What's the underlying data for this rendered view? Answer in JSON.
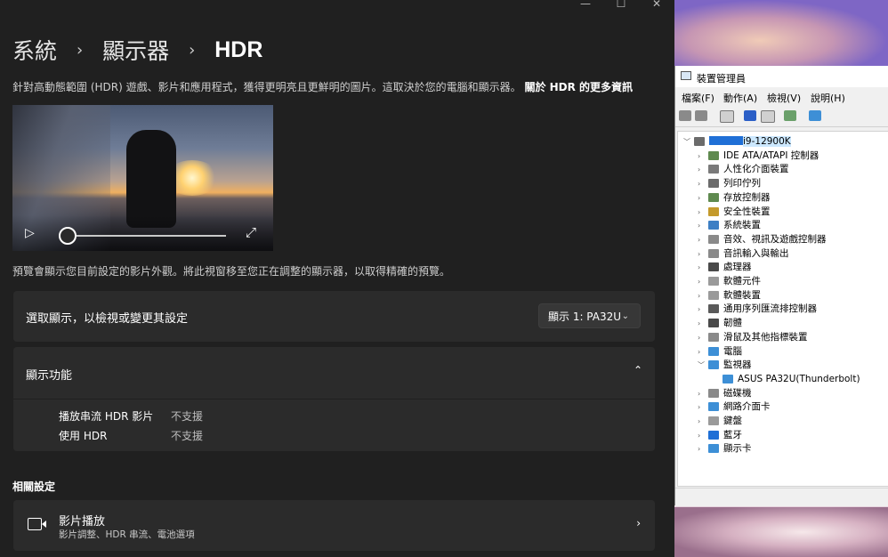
{
  "window": {
    "minimize_icon": "minimize-icon",
    "maximize_icon": "maximize-icon",
    "close_icon": "close-icon",
    "min_glyph": "—",
    "max_glyph": "☐",
    "close_glyph": "✕"
  },
  "breadcrumb": {
    "items": [
      "系統",
      "顯示器",
      "HDR"
    ],
    "separator": "›"
  },
  "description": {
    "text": "針對高動態範圍 (HDR) 遊戲、影片和應用程式，獲得更明亮且更鮮明的圖片。這取決於您的電腦和顯示器。",
    "link": "關於 HDR 的更多資訊"
  },
  "video_player": {
    "play_glyph": "▷",
    "fullscreen_glyph": "⤢",
    "progress": 0
  },
  "preview_note": "預覽會顯示您目前設定的影片外觀。將此視窗移至您正在調整的顯示器，以取得精確的預覽。",
  "select_display": {
    "label": "選取顯示，以檢視或變更其設定",
    "value": "顯示 1: PA32U",
    "chevron": "⌄"
  },
  "display_features": {
    "label": "顯示功能",
    "chevron": "⌃",
    "rows": [
      {
        "name": "播放串流 HDR 影片",
        "value": "不支援"
      },
      {
        "name": "使用 HDR",
        "value": "不支援"
      }
    ]
  },
  "related": {
    "title": "相關設定",
    "video": {
      "title": "影片播放",
      "subtitle": "影片調整、HDR 串流、電池選項",
      "chevron": "›"
    }
  },
  "device_manager": {
    "title": "裝置管理員",
    "menu": [
      "檔案(F)",
      "動作(A)",
      "檢視(V)",
      "說明(H)"
    ],
    "root": "i9-12900K",
    "tree": [
      {
        "label": "IDE ATA/ATAPI 控制器",
        "expanded": false,
        "color": "#5f8a4f"
      },
      {
        "label": "人性化介面裝置",
        "expanded": false,
        "color": "#7a7a7a"
      },
      {
        "label": "列印佇列",
        "expanded": false,
        "color": "#6b6b6b"
      },
      {
        "label": "存放控制器",
        "expanded": false,
        "color": "#5f8a4f"
      },
      {
        "label": "安全性裝置",
        "expanded": false,
        "color": "#c49a2c"
      },
      {
        "label": "系統裝置",
        "expanded": false,
        "color": "#3d7fc4"
      },
      {
        "label": "音效、視訊及遊戲控制器",
        "expanded": false,
        "color": "#8a8a8a"
      },
      {
        "label": "音訊輸入與輸出",
        "expanded": false,
        "color": "#8a8a8a"
      },
      {
        "label": "處理器",
        "expanded": false,
        "color": "#4a4a4a"
      },
      {
        "label": "軟體元件",
        "expanded": false,
        "color": "#9a9a9a"
      },
      {
        "label": "軟體裝置",
        "expanded": false,
        "color": "#9a9a9a"
      },
      {
        "label": "通用序列匯流排控制器",
        "expanded": false,
        "color": "#5a5a5a"
      },
      {
        "label": "韌體",
        "expanded": false,
        "color": "#4a4a4a"
      },
      {
        "label": "滑鼠及其他指標裝置",
        "expanded": false,
        "color": "#8a8a8a"
      },
      {
        "label": "電腦",
        "expanded": false,
        "color": "#3d8fd6"
      },
      {
        "label": "監視器",
        "expanded": true,
        "color": "#3d8fd6"
      },
      {
        "label": "ASUS PA32U(Thunderbolt)",
        "child": true,
        "color": "#3d8fd6"
      },
      {
        "label": "磁碟機",
        "expanded": false,
        "color": "#8a8a8a"
      },
      {
        "label": "網路介面卡",
        "expanded": false,
        "color": "#3d8fd6"
      },
      {
        "label": "鍵盤",
        "expanded": false,
        "color": "#9a9a9a"
      },
      {
        "label": "藍牙",
        "expanded": false,
        "color": "#1f6fd6"
      },
      {
        "label": "顯示卡",
        "expanded": false,
        "color": "#3d8fd6"
      }
    ]
  },
  "colors": {
    "settings_bg": "#202020",
    "card_bg": "#2b2b2b",
    "selection_blue": "#cce8ff"
  }
}
